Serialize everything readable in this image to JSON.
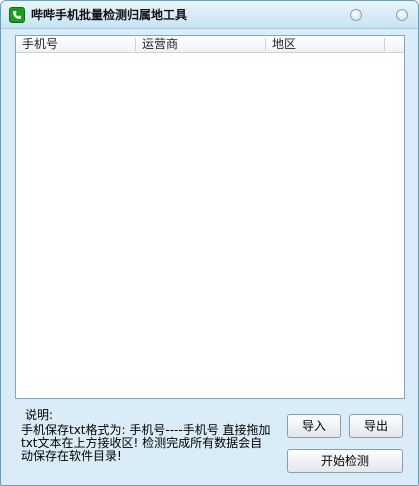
{
  "window": {
    "title": "哔哔手机批量检测归属地工具"
  },
  "list": {
    "columns": [
      "手机号",
      "运营商",
      "地区"
    ],
    "rows": []
  },
  "note": {
    "title": "说明:",
    "body": "手机保存txt格式为: 手机号----手机号 直接拖加txt文本在上方接收区! 检测完成所有数据会自动保存在软件目录!"
  },
  "buttons": {
    "import_label": "导入",
    "export_label": "导出",
    "start_label": "开始检测"
  },
  "colors": {
    "window_bg": "#d9ecf7",
    "border": "#5f9fc8",
    "icon_green": "#1aa01a"
  },
  "icons": {
    "app": "phone-icon",
    "minimize": "minimize-icon",
    "close": "close-icon"
  }
}
